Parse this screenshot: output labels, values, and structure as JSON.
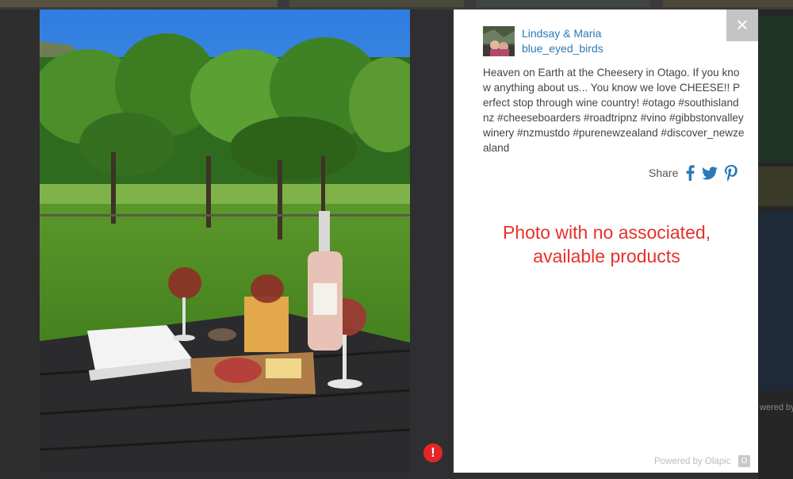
{
  "user": {
    "name": "Lindsay & Maria",
    "handle": "blue_eyed_birds"
  },
  "post": {
    "caption": "Heaven on Earth at the Cheesery in Otago. If you know anything about us... You know we love CHEESE!! Perfect stop through wine country! #otago #southislandnz #cheeseboarders #roadtripnz #vino #gibbstonvalleywinery #nzmustdo #purenewzealand #discover_newzealand"
  },
  "share": {
    "label": "Share",
    "icons": [
      "facebook-icon",
      "twitter-icon",
      "pinterest-icon"
    ]
  },
  "note": "Photo with no associated, available products",
  "footer": {
    "powered_by": "Powered by Olapic"
  },
  "background": {
    "powered_fragment": "wered by"
  },
  "close_glyph": "×",
  "alert_glyph": "!",
  "colors": {
    "link": "#2a7ab8",
    "note": "#e8302a",
    "alert": "#e32626",
    "overlay": "#2f2f31"
  }
}
